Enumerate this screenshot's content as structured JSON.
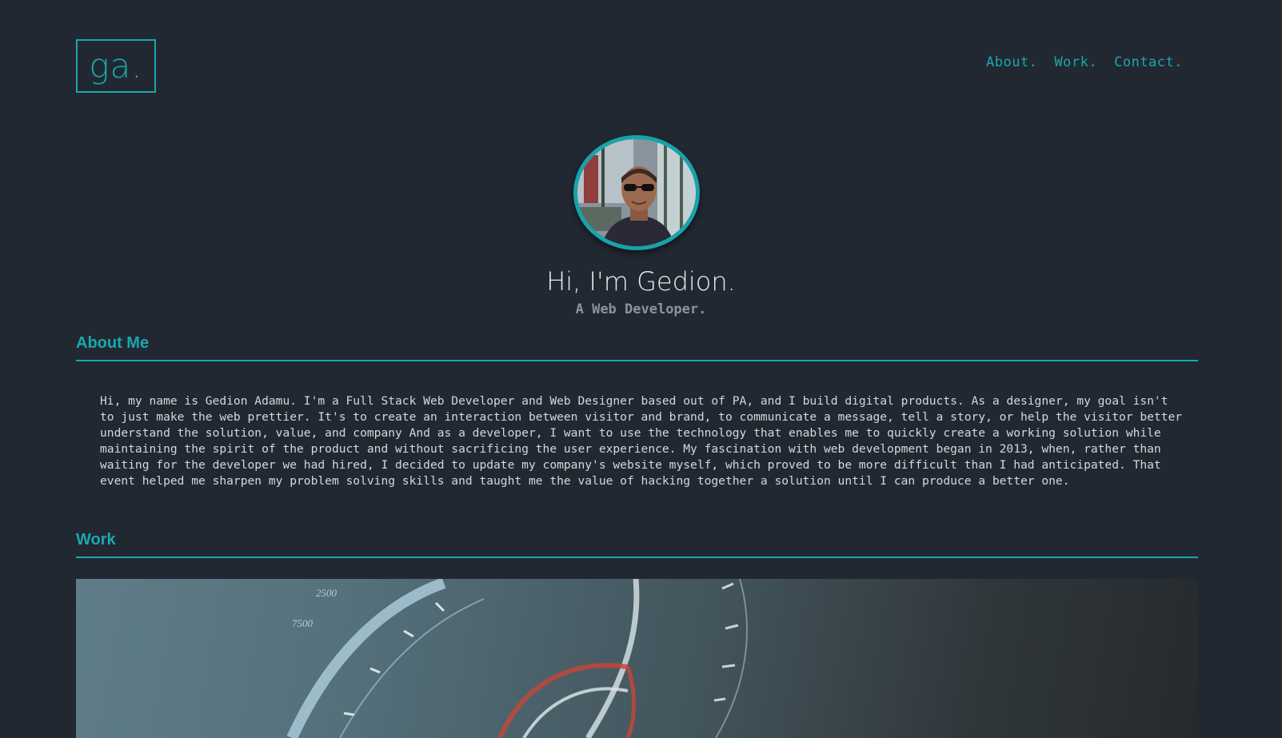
{
  "header": {
    "logo_text": "ga.",
    "nav": [
      {
        "label": "About."
      },
      {
        "label": "Work."
      },
      {
        "label": "Contact."
      }
    ]
  },
  "hero": {
    "title": "Hi, I'm Gedion.",
    "subtitle": "A Web Developer."
  },
  "about": {
    "heading": "About Me",
    "body": "Hi, my name is Gedion Adamu. I'm a Full Stack Web Developer and Web Designer based out of PA, and I build digital products. As a designer, my goal isn't to just make the web prettier. It's to create an interaction between visitor and brand, to communicate a message, tell a story, or help the visitor better understand the solution, value, and company And as a developer, I want to use the technology that enables me to quickly create a working solution while maintaining the spirit of the product and without sacrificing the user experience. My fascination with web development began in 2013, when, rather than waiting for the developer we had hired, I decided to update my company's website myself, which proved to be more difficult than I had anticipated. That event helped me sharpen my problem solving skills and taught me the value of hacking together a solution until I can produce a better one."
  },
  "work": {
    "heading": "Work",
    "image_text_1": "2500",
    "image_text_2": "7500"
  },
  "colors": {
    "background": "#222831",
    "accent": "#1aa7b0",
    "text": "#d4d8dc",
    "muted": "#8d939a"
  }
}
